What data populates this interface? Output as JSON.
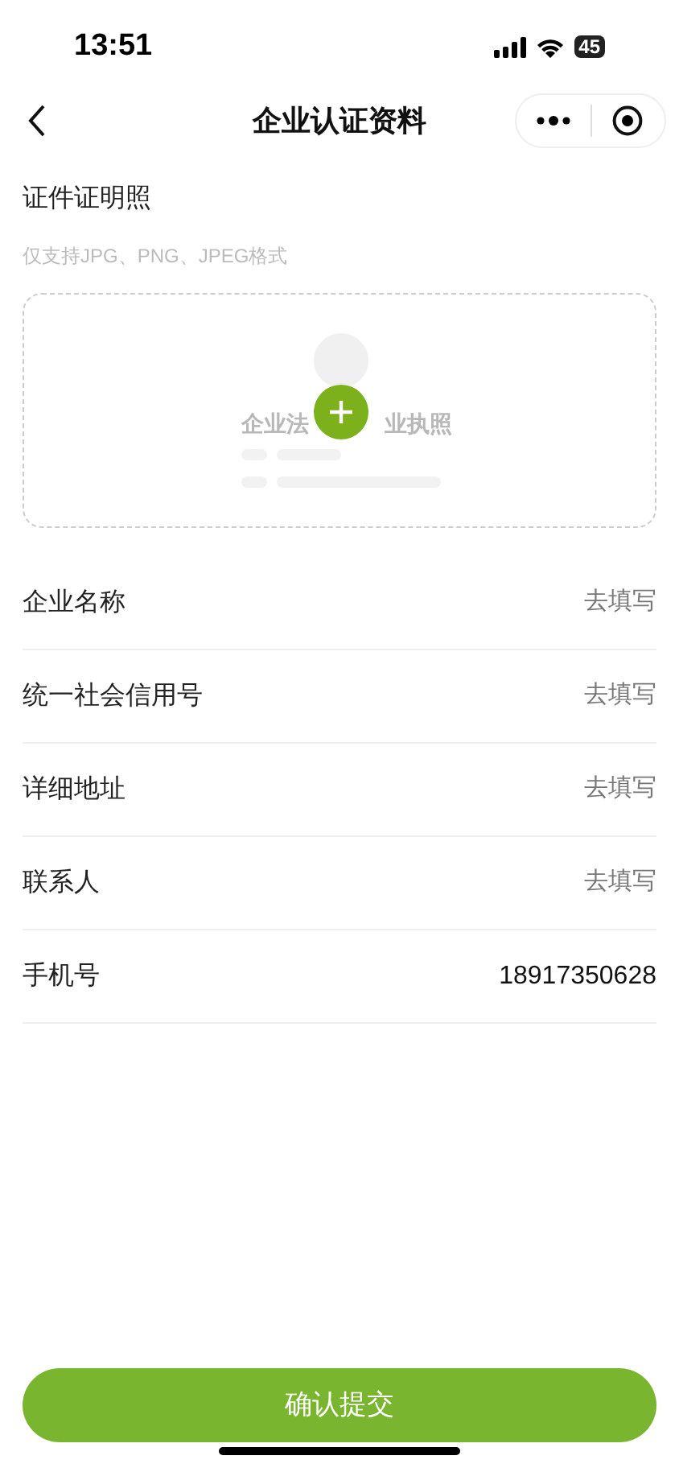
{
  "status_bar": {
    "time": "13:51",
    "battery": "45"
  },
  "nav": {
    "title": "企业认证资料"
  },
  "upload": {
    "label": "证件证明照",
    "hint": "仅支持JPG、PNG、JPEG格式",
    "sample_text_left": "企业法",
    "sample_text_right": "业执照"
  },
  "fields": [
    {
      "label": "企业名称",
      "value": "去填写",
      "filled": false
    },
    {
      "label": "统一社会信用号",
      "value": "去填写",
      "filled": false
    },
    {
      "label": "详细地址",
      "value": "去填写",
      "filled": false
    },
    {
      "label": "联系人",
      "value": "去填写",
      "filled": false
    },
    {
      "label": "手机号",
      "value": "18917350628",
      "filled": true
    }
  ],
  "submit": {
    "label": "确认提交"
  }
}
